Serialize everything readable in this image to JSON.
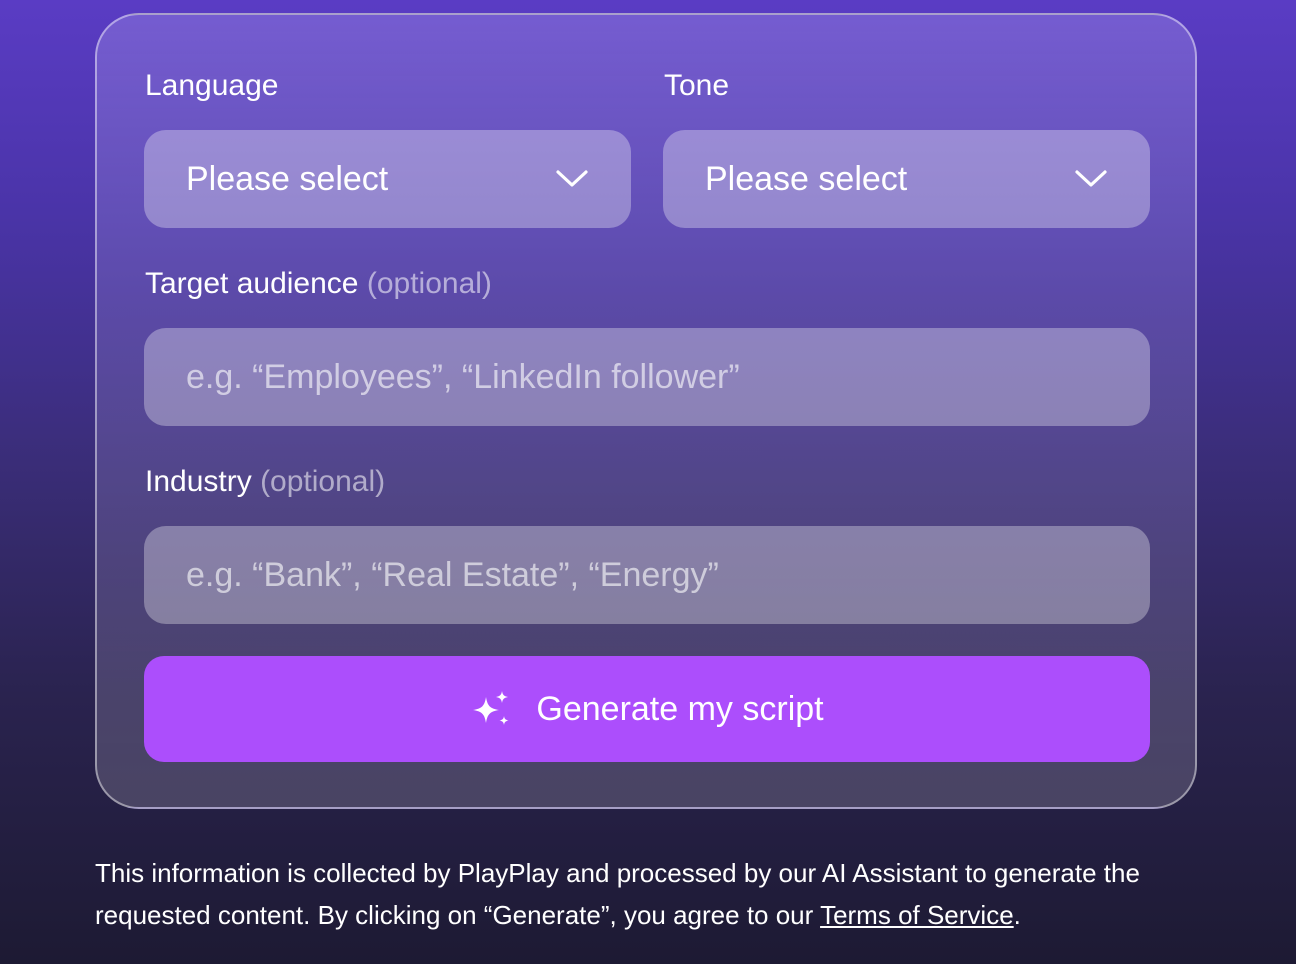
{
  "form": {
    "language": {
      "label": "Language",
      "value": "Please select",
      "icon": "chevron-down-icon"
    },
    "tone": {
      "label": "Tone",
      "value": "Please select",
      "icon": "chevron-down-icon"
    },
    "target_audience": {
      "label": "Target audience",
      "optional": "(optional)",
      "placeholder": "e.g. “Employees”, “LinkedIn follower”"
    },
    "industry": {
      "label": "Industry",
      "optional": "(optional)",
      "placeholder": "e.g. “Bank”, “Real Estate”, “Energy”"
    },
    "generate_button": {
      "label": "Generate my script",
      "icon": "sparkle-icon"
    }
  },
  "disclaimer": {
    "text_before": "This information is collected by PlayPlay and processed by our AI Assistant to generate the requested content. By clicking on “Generate”, you agree to our ",
    "link": "Terms of Service",
    "text_after": "."
  },
  "colors": {
    "button": "#ac4efc",
    "background_top": "#5a3cc4",
    "background_bottom": "#1d1a33"
  }
}
